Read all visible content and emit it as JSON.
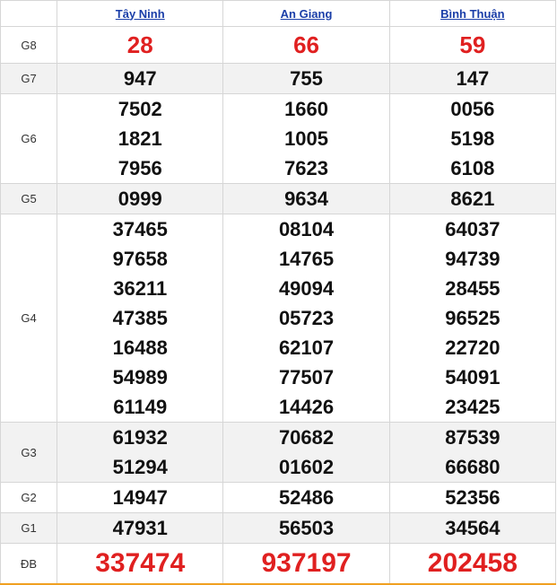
{
  "provinces": [
    "Tây Ninh",
    "An Giang",
    "Bình Thuận"
  ],
  "rows": [
    {
      "label": "G8",
      "values": [
        [
          "28"
        ],
        [
          "66"
        ],
        [
          "59"
        ]
      ]
    },
    {
      "label": "G7",
      "values": [
        [
          "947"
        ],
        [
          "755"
        ],
        [
          "147"
        ]
      ]
    },
    {
      "label": "G6",
      "values": [
        [
          "7502",
          "1821",
          "7956"
        ],
        [
          "1660",
          "1005",
          "7623"
        ],
        [
          "0056",
          "5198",
          "6108"
        ]
      ]
    },
    {
      "label": "G5",
      "values": [
        [
          "0999"
        ],
        [
          "9634"
        ],
        [
          "8621"
        ]
      ]
    },
    {
      "label": "G4",
      "values": [
        [
          "37465",
          "97658",
          "36211",
          "47385",
          "16488",
          "54989",
          "61149"
        ],
        [
          "08104",
          "14765",
          "49094",
          "05723",
          "62107",
          "77507",
          "14426"
        ],
        [
          "64037",
          "94739",
          "28455",
          "96525",
          "22720",
          "54091",
          "23425"
        ]
      ]
    },
    {
      "label": "G3",
      "values": [
        [
          "61932",
          "51294"
        ],
        [
          "70682",
          "01602"
        ],
        [
          "87539",
          "66680"
        ]
      ]
    },
    {
      "label": "G2",
      "values": [
        [
          "14947"
        ],
        [
          "52486"
        ],
        [
          "52356"
        ]
      ]
    },
    {
      "label": "G1",
      "values": [
        [
          "47931"
        ],
        [
          "56503"
        ],
        [
          "34564"
        ]
      ]
    },
    {
      "label": "ĐB",
      "values": [
        [
          "337474"
        ],
        [
          "937197"
        ],
        [
          "202458"
        ]
      ]
    }
  ],
  "colors": {
    "accent_red": "#e02020",
    "link_blue": "#1a3ea8",
    "row_shade": "#f2f2f2",
    "bottom_border": "#f0a020"
  }
}
